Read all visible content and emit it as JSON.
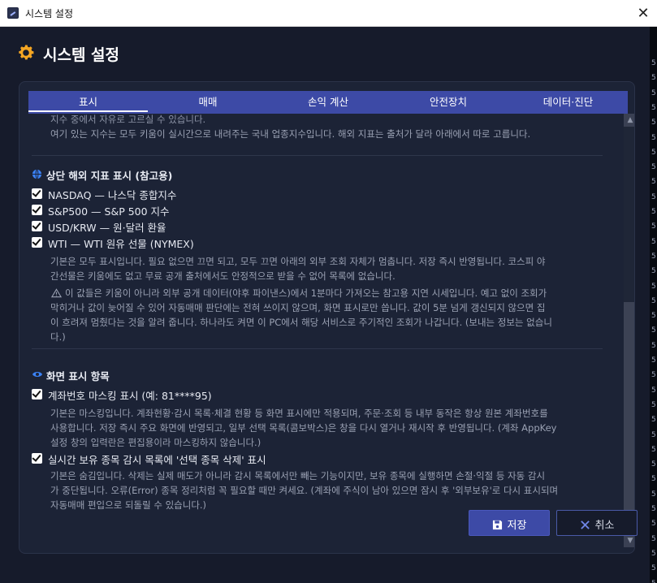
{
  "window": {
    "title": "시스템 설정",
    "close_glyph": "✕"
  },
  "header": {
    "title": "시스템 설정",
    "icon": "gear-icon",
    "icon_color": "#f5a623"
  },
  "tabs": [
    {
      "label": "표시",
      "active": true
    },
    {
      "label": "매매"
    },
    {
      "label": "손익 계산"
    },
    {
      "label": "안전장치"
    },
    {
      "label": "데이터·진단"
    }
  ],
  "top_section": {
    "cut_line": "지수 중에서 자유로 고르실 수 있습니다.",
    "description": "여기 있는 지수는 모두 키움이 실시간으로 내려주는 국내 업종지수입니다. 해외 지표는 출처가 달라 아래에서 따로 고릅니다."
  },
  "overseas": {
    "title": "상단 해외 지표 표시 (참고용)",
    "icon": "globe-icon",
    "items": [
      {
        "label": "NASDAQ — 나스닥 종합지수",
        "checked": true
      },
      {
        "label": "S&P500 — S&P 500 지수",
        "checked": true
      },
      {
        "label": "USD/KRW — 원·달러 환율",
        "checked": true
      },
      {
        "label": "WTI — WTI 원유 선물 (NYMEX)",
        "checked": true
      }
    ],
    "desc_lines": [
      "기본은 모두 표시입니다. 필요 없으면 끄면 되고, 모두 끄면 아래의 외부 조회 자체가 멈춥니다. 저장 즉시 반영됩니다. 코스피 야",
      "간선물은 키움에도 없고 무료 공개 출처에서도 안정적으로 받을 수 없어 목록에 없습니다."
    ],
    "warning_lines": [
      "이 값들은 키움이 아니라 외부 공개 데이터(야후 파이낸스)에서 1분마다 가져오는 참고용 지연 시세입니다. 예고 없이 조회가",
      "막히거나 값이 늦어질 수 있어 자동매매 판단에는 전혀 쓰이지 않으며, 화면 표시로만 씁니다. 값이 5분 넘게 갱신되지 않으면 집",
      "이 흐려져 멈췄다는 것을 알려 줍니다. 하나라도 켜면 이 PC에서 해당 서비스로 주기적인 조회가 나갑니다. (보내는 정보는 없습니",
      "다.)"
    ]
  },
  "display_items": {
    "title": "화면 표시 항목",
    "icon": "eye-icon",
    "mask": {
      "label": "계좌번호 마스킹 표시 (예: 81****95)",
      "checked": true,
      "desc_lines": [
        "기본은 마스킹입니다. 계좌현황·감시 목록·체결 현황 등 화면 표시에만 적용되며, 주문·조회 등 내부 동작은 항상 원본 계좌번호를",
        "사용합니다. 저장 즉시 주요 화면에 반영되고, 일부 선택 목록(콤보박스)은 창을 다시 열거나 재시작 후 반영됩니다. (계좌 AppKey",
        "설정 창의 입력란은 편집용이라 마스킹하지 않습니다.)"
      ]
    },
    "delete_btn": {
      "label": "실시간 보유 종목 감시 목록에 '선택 종목 삭제' 표시",
      "checked": true,
      "desc_lines": [
        "기본은 숨김입니다. 삭제는 실제 매도가 아니라 감시 목록에서만 빼는 기능이지만, 보유 종목에 실행하면 손절·익절 등 자동 감시",
        "가 중단됩니다. 오류(Error) 종목 정리처럼 꼭 필요할 때만 켜세요. (계좌에 주식이 남아 있으면 잠시 후 '외부보유'로 다시 표시되며",
        "자동매매 편입으로 되돌릴 수 있습니다.)"
      ]
    }
  },
  "buttons": {
    "save": "저장",
    "cancel": "취소"
  },
  "colors": {
    "accent": "#3d4aa6",
    "background": "#161b2b",
    "panel": "#1c2336"
  },
  "right_strip_chars": [
    "5",
    "5",
    "5",
    "5",
    "5",
    "5",
    "5",
    "5",
    "5",
    "5",
    "5",
    "5",
    "5",
    "5",
    "5",
    "5",
    "5",
    "5",
    "5",
    "5",
    "5",
    "5",
    "5",
    "5",
    "5",
    "5",
    "5",
    "5",
    "5",
    "5",
    "5",
    "5",
    "5",
    "5",
    "5",
    "5",
    "5"
  ]
}
